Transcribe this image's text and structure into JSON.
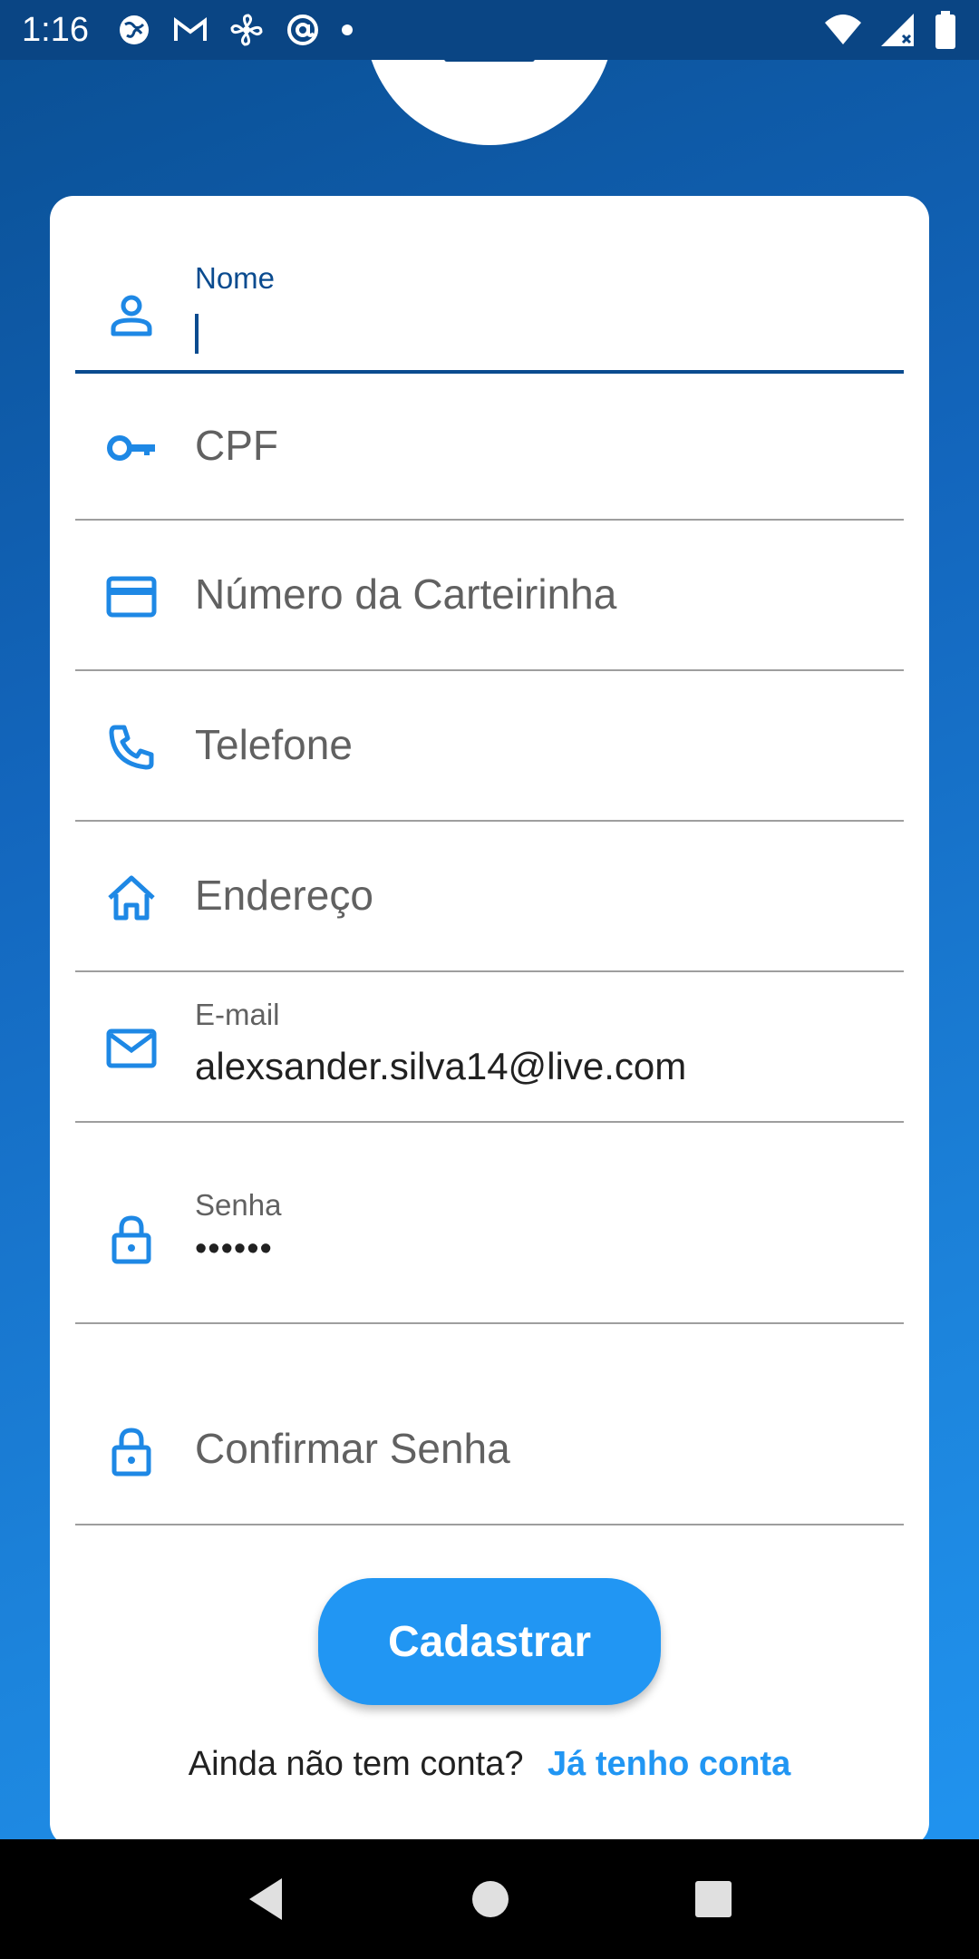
{
  "status_bar": {
    "time": "1:16",
    "icons": [
      "globe-icon",
      "gmail-icon",
      "fan-icon",
      "at-sign-icon",
      "dot-icon"
    ],
    "right_icons": [
      "wifi-icon",
      "signal-icon",
      "battery-icon"
    ]
  },
  "form": {
    "nome": {
      "label": "Nome",
      "value": ""
    },
    "cpf": {
      "placeholder": "CPF"
    },
    "carteirinha": {
      "placeholder": "Número da Carteirinha"
    },
    "telefone": {
      "placeholder": "Telefone"
    },
    "endereco": {
      "placeholder": "Endereço"
    },
    "email": {
      "label": "E-mail",
      "value": "alexsander.silva14@live.com"
    },
    "senha": {
      "label": "Senha",
      "value": "••••••"
    },
    "confirmar_senha": {
      "placeholder": "Confirmar Senha"
    }
  },
  "submit_label": "Cadastrar",
  "footer": {
    "question": "Ainda não tem conta?",
    "link": "Já tenho conta"
  },
  "colors": {
    "accent": "#2196f3",
    "dark_blue": "#0a4b8f",
    "icon_blue": "#1e88e5"
  }
}
